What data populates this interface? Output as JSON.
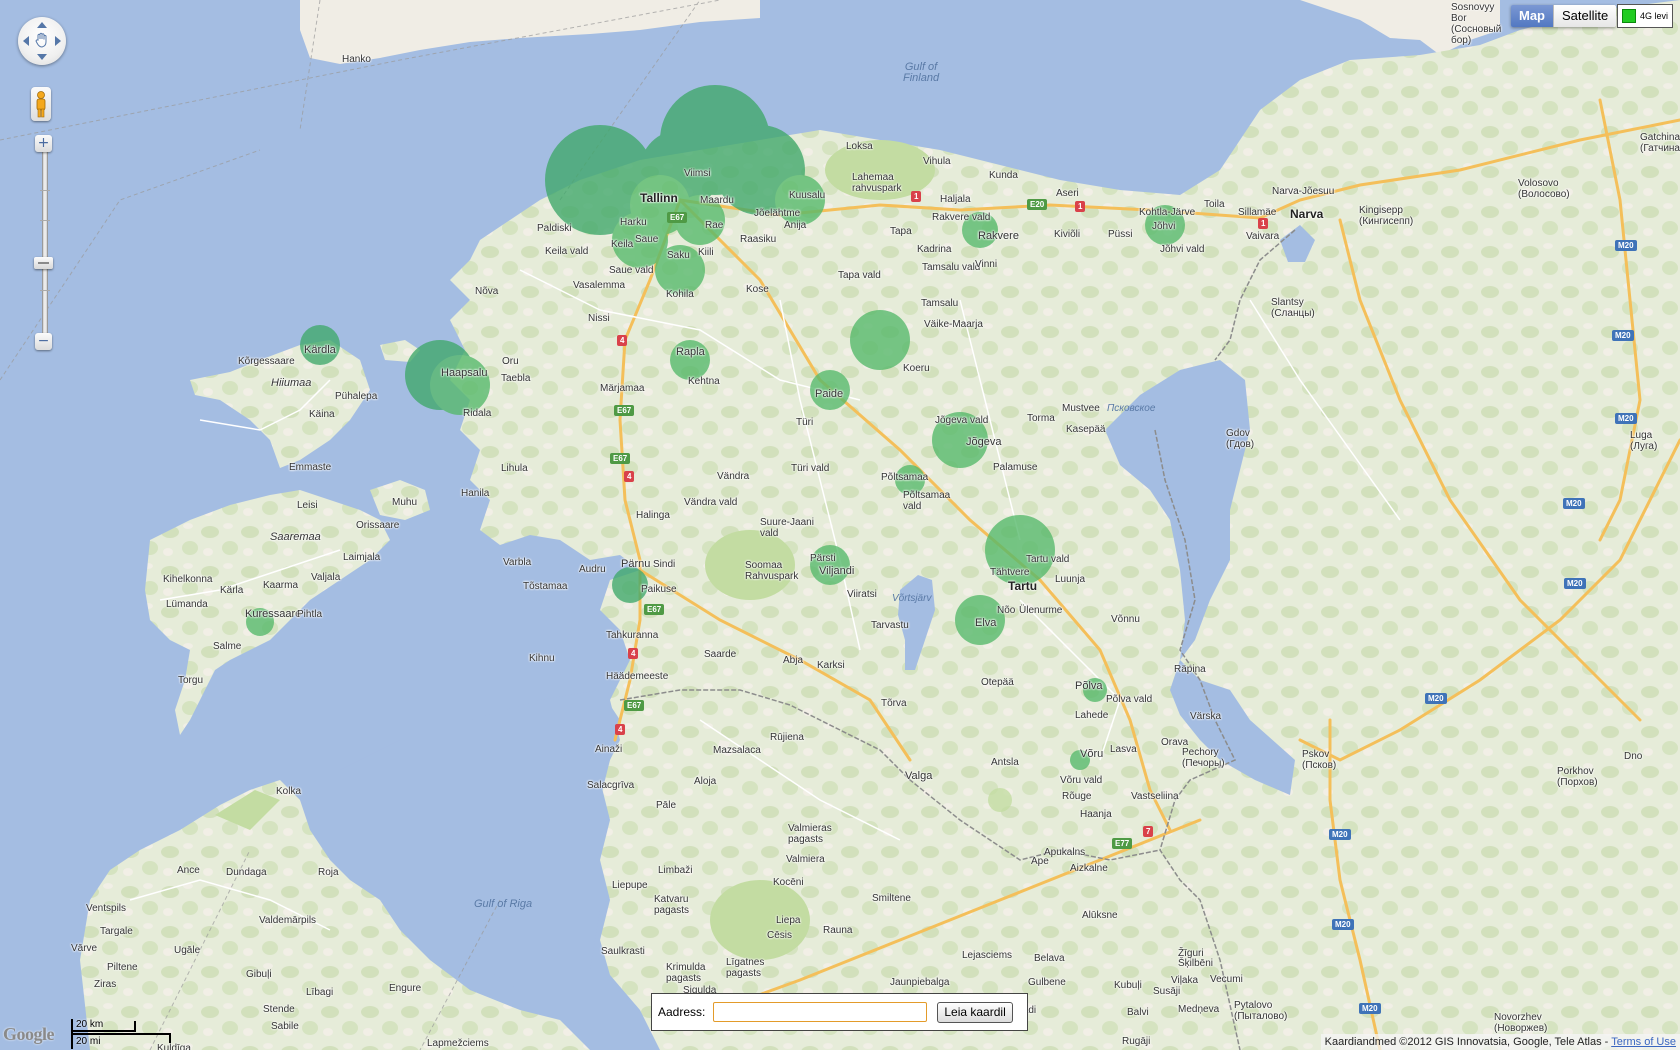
{
  "map": {
    "colors": {
      "water": "#a4bde2",
      "land": "#f0ede5",
      "land_green": "#d8e6c4",
      "park": "#c3dca2",
      "coverage": "#55b96a",
      "coverage_dense": "#3fa86a",
      "road_major": "#f4bf5a",
      "road_minor": "#ffffff",
      "border": "#8c8c8c"
    },
    "water_labels": {
      "gulf_of_finland": "Gulf of\nFinland",
      "gulf_of_riga": "Gulf of Riga",
      "pskovskoye": "Псковское",
      "vortsjarv": "Võrtsjärv"
    },
    "island_labels": {
      "hiiumaa": "Hiiumaa",
      "saaremaa": "Saaremaa"
    },
    "places": [
      "Tallinn",
      "Tartu",
      "Narva",
      "Pärnu",
      "Viljandi",
      "Haapsalu",
      "Kuressaare",
      "Kärdla",
      "Rakvere",
      "Paide",
      "Jõgeva",
      "Valga",
      "Võru",
      "Põlva",
      "Elva",
      "Rapla",
      "Keila",
      "Maardu",
      "Viimsi",
      "Harku",
      "Saue",
      "Saku",
      "Kiili",
      "Rae",
      "Jõelähtme",
      "Kuusalu",
      "Anija",
      "Raasiku",
      "Kohila",
      "Kose",
      "Tapa",
      "Tapa vald",
      "Tamsalu",
      "Tamsalu vald",
      "Kadrina",
      "Vinni",
      "Rakvere vald",
      "Haljala",
      "Vihula",
      "Kunda",
      "Aseri",
      "Kiviõli",
      "Püssi",
      "Kohtla-Järve",
      "Jõhvi",
      "Jõhvi vald",
      "Toila",
      "Sillamäe",
      "Vaivara",
      "Narva-Jõesuu",
      "Loksa",
      "Lahemaa\nrahvuspark",
      "Paldiski",
      "Keila vald",
      "Saue vald",
      "Vasalemma",
      "Nõva",
      "Nissi",
      "Märjamaa",
      "Kehtna",
      "Taebla",
      "Oru",
      "Ridala",
      "Lihula",
      "Hanila",
      "Varbla",
      "Audru",
      "Tõstamaa",
      "Sindi",
      "Paikuse",
      "Kihnu",
      "Tahkuranna",
      "Häädemeeste",
      "Saarde",
      "Abja",
      "Karksi",
      "Tõrva",
      "Otepää",
      "Põlva vald",
      "Lahede",
      "Räpina",
      "Värska",
      "Orava",
      "Pechory\n(Печоры)",
      "Lasva",
      "Antsla",
      "Võru vald",
      "Rõuge",
      "Vastseliina",
      "Haanja",
      "Nõo",
      "Ülenurme",
      "Luunja",
      "Tartu vald",
      "Tähtvere",
      "Võnnu",
      "Palamuse",
      "Põltsamaa",
      "Põltsamaa\nvald",
      "Jõgeva vald",
      "Torma",
      "Mustvee",
      "Kasepää",
      "Väike-Maarja",
      "Koeru",
      "Türi",
      "Türi vald",
      "Vändra",
      "Vändra vald",
      "Suure-Jaani\nvald",
      "Pärsti",
      "Viiratsi",
      "Tarvastu",
      "Halinga",
      "Soomaa\nRahvuspark",
      "Kõrgessaare",
      "Käina",
      "Pühalepa",
      "Emmaste",
      "Leisi",
      "Muhu",
      "Orissaare",
      "Laimjala",
      "Valjala",
      "Kihelkonna",
      "Kaarma",
      "Lümanda",
      "Kärla",
      "Pihtla",
      "Salme",
      "Torgu",
      "Hanko",
      "Kingisepp\n(Кингисепп)",
      "Slantsy\n(Сланцы)",
      "Gdov\n(Гдов)",
      "Volosovo\n(Волосово)",
      "Luga\n(Луга)",
      "Pskov\n(Псков)",
      "Porkhov\n(Порхов)",
      "Dno",
      "Gatchina\n(Гатчина)",
      "Sosnovyy\nBor\n(Сосновый\nбор)",
      "Novorzhev\n(Новоржев)",
      "Pytalovo\n(Пыталово)",
      "Ainaži",
      "Mazsalaca",
      "Rūjiena",
      "Salacgrīva",
      "Aloja",
      "Valmieras\npagasts",
      "Valmiera",
      "Limbaži",
      "Pāle",
      "Liepupe",
      "Katvaru\npagasts",
      "Kocēni",
      "Smiltene",
      "Aizkalne",
      "Alūksne",
      "Liepa",
      "Rauna",
      "Cēsis",
      "Saulkrasti",
      "Krimulda\npagasts",
      "Līgatnes\npagasts",
      "Sigulda",
      "Lejasciems",
      "Jaunpiebalga",
      "Gulbene",
      "Stradi",
      "Belava",
      "Kubuļi",
      "Balvi",
      "Šķilbēni",
      "Viļaka",
      "Žīguri",
      "Medņeva",
      "Susāji",
      "Vecumi",
      "Kolka",
      "Ance",
      "Dundaga",
      "Roja",
      "Ventspils",
      "Valdemārpils",
      "Targale",
      "Ugāle",
      "Vārve",
      "Piltene",
      "Ziras",
      "Gibuļi",
      "Stende",
      "Lībagi",
      "Engure",
      "Sabile",
      "Lapmežciems",
      "Kuldīga",
      "Rugāji",
      "Ape",
      "Apukalns"
    ],
    "road_shields": [
      "1",
      "4",
      "7",
      "E20",
      "E67",
      "E77",
      "M20"
    ]
  },
  "controls": {
    "zoom_in": "+",
    "zoom_out": "−",
    "map_type": {
      "map_label": "Map",
      "satellite_label": "Satellite"
    }
  },
  "legend": {
    "label": "4G levi",
    "color": "#22cc22"
  },
  "address": {
    "label": "Aadress:",
    "value": "",
    "button_label": "Leia kaardil"
  },
  "footer": {
    "logo": "Google",
    "scale_km": "20 km",
    "scale_mi": "20 mi",
    "attribution": "Kaardiandmed ©2012 GIS Innovatsia, Google, Tele Atlas - ",
    "terms_link": "Terms of Use"
  }
}
